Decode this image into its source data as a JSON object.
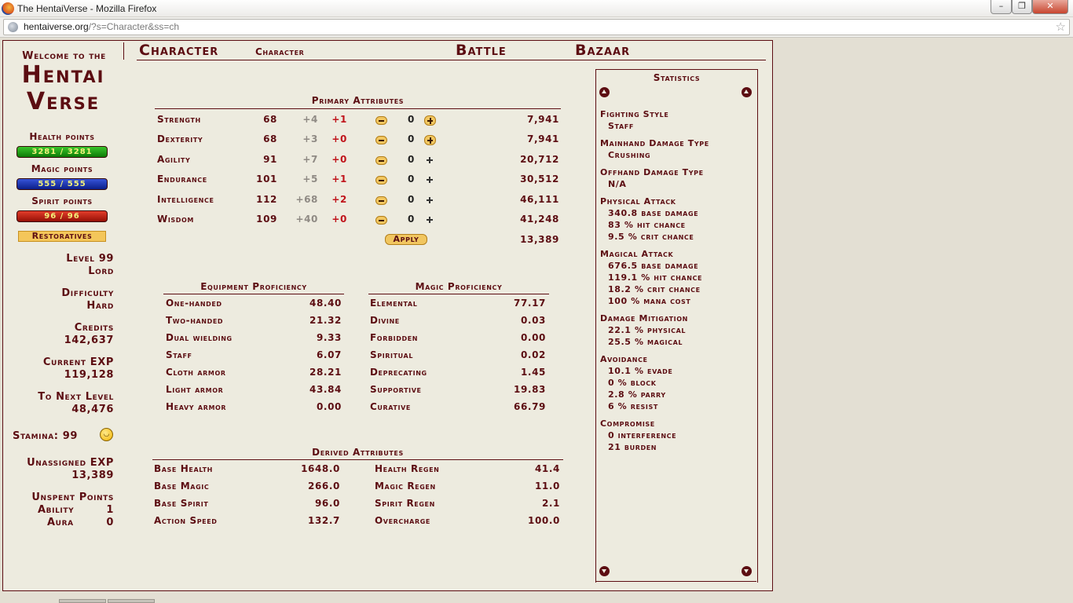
{
  "browser": {
    "window_title": "The HentaiVerse - Mozilla Firefox",
    "url_host": "hentaiverse.org",
    "url_path": "/?s=Character&ss=ch",
    "min_label": "–",
    "max_label": "❐",
    "close_label": "✕"
  },
  "logo": {
    "welcome": "Welcome to the",
    "line1": "Hentai",
    "line2": "Verse"
  },
  "vitals": {
    "health_label": "Health points",
    "health_value": "3281 / 3281",
    "magic_label": "Magic points",
    "magic_value": "555 / 555",
    "spirit_label": "Spirit points",
    "spirit_value": "96 / 96",
    "restoratives": "Restoratives"
  },
  "player": {
    "level": "Level 99",
    "title": "Lord",
    "difficulty_label": "Difficulty",
    "difficulty": "Hard",
    "credits_label": "Credits",
    "credits": "142,637",
    "exp_label": "Current EXP",
    "exp": "119,128",
    "next_label": "To Next Level",
    "next": "48,476",
    "stamina": "Stamina: 99",
    "unassigned_label": "Unassigned EXP",
    "unassigned": "13,389",
    "unspent_label": "Unspent Points",
    "ability_label": "Ability",
    "ability": "1",
    "aura_label": "Aura",
    "aura": "0"
  },
  "menu": {
    "character": "Character",
    "character_sub": "Character",
    "battle": "Battle",
    "bazaar": "Bazaar"
  },
  "primary": {
    "header": "Primary Attributes",
    "rows": [
      {
        "name": "Strength",
        "base": "68",
        "bonus": "+4",
        "mod": "+1",
        "assign": "0",
        "cost": "7,941"
      },
      {
        "name": "Dexterity",
        "base": "68",
        "bonus": "+3",
        "mod": "+0",
        "assign": "0",
        "cost": "7,941"
      },
      {
        "name": "Agility",
        "base": "91",
        "bonus": "+7",
        "mod": "+0",
        "assign": "0",
        "cost": "20,712"
      },
      {
        "name": "Endurance",
        "base": "101",
        "bonus": "+5",
        "mod": "+1",
        "assign": "0",
        "cost": "30,512"
      },
      {
        "name": "Intelligence",
        "base": "112",
        "bonus": "+68",
        "mod": "+2",
        "assign": "0",
        "cost": "46,111"
      },
      {
        "name": "Wisdom",
        "base": "109",
        "bonus": "+40",
        "mod": "+0",
        "assign": "0",
        "cost": "41,248"
      }
    ],
    "apply": "Apply",
    "remaining": "13,389"
  },
  "equipment": {
    "header": "Equipment Proficiency",
    "rows": [
      {
        "name": "One-handed",
        "value": "48.40"
      },
      {
        "name": "Two-handed",
        "value": "21.32"
      },
      {
        "name": "Dual wielding",
        "value": "9.33"
      },
      {
        "name": "Staff",
        "value": "6.07"
      },
      {
        "name": "Cloth armor",
        "value": "28.21"
      },
      {
        "name": "Light armor",
        "value": "43.84"
      },
      {
        "name": "Heavy armor",
        "value": "0.00"
      }
    ]
  },
  "magic": {
    "header": "Magic Proficiency",
    "rows": [
      {
        "name": "Elemental",
        "value": "77.17"
      },
      {
        "name": "Divine",
        "value": "0.03"
      },
      {
        "name": "Forbidden",
        "value": "0.00"
      },
      {
        "name": "Spiritual",
        "value": "0.02"
      },
      {
        "name": "Deprecating",
        "value": "1.45"
      },
      {
        "name": "Supportive",
        "value": "19.83"
      },
      {
        "name": "Curative",
        "value": "66.79"
      }
    ]
  },
  "derived": {
    "header": "Derived Attributes",
    "left": [
      {
        "name": "Base Health",
        "value": "1648.0"
      },
      {
        "name": "Base Magic",
        "value": "266.0"
      },
      {
        "name": "Base Spirit",
        "value": "96.0"
      },
      {
        "name": "Action Speed",
        "value": "132.7"
      }
    ],
    "right": [
      {
        "name": "Health Regen",
        "value": "41.4"
      },
      {
        "name": "Magic Regen",
        "value": "11.0"
      },
      {
        "name": "Spirit Regen",
        "value": "2.1"
      },
      {
        "name": "Overcharge",
        "value": "100.0"
      }
    ]
  },
  "statistics": {
    "header": "Statistics",
    "lines": [
      {
        "text": "Fighting Style",
        "indent": false
      },
      {
        "text": "Staff",
        "indent": true
      },
      {
        "text": "Mainhand Damage Type",
        "indent": false
      },
      {
        "text": "Crushing",
        "indent": true
      },
      {
        "text": "Offhand Damage Type",
        "indent": false
      },
      {
        "text": "N/A",
        "indent": true
      },
      {
        "text": "Physical Attack",
        "indent": false
      },
      {
        "text": "340.8 base damage",
        "indent": true
      },
      {
        "text": "83 % hit chance",
        "indent": true
      },
      {
        "text": "9.5 % crit chance",
        "indent": true
      },
      {
        "text": "Magical Attack",
        "indent": false
      },
      {
        "text": "676.5 base damage",
        "indent": true
      },
      {
        "text": "119.1 % hit chance",
        "indent": true
      },
      {
        "text": "18.2 % crit chance",
        "indent": true
      },
      {
        "text": "100 % mana cost",
        "indent": true
      },
      {
        "text": "Damage Mitigation",
        "indent": false
      },
      {
        "text": "22.1 % physical",
        "indent": true
      },
      {
        "text": "25.5 % magical",
        "indent": true
      },
      {
        "text": "Avoidance",
        "indent": false
      },
      {
        "text": "10.1 % evade",
        "indent": true
      },
      {
        "text": "0 % block",
        "indent": true
      },
      {
        "text": "2.8 % parry",
        "indent": true
      },
      {
        "text": "6 % resist",
        "indent": true
      },
      {
        "text": "Compromise",
        "indent": false
      },
      {
        "text": "0 interference",
        "indent": true
      },
      {
        "text": "21 burden",
        "indent": true
      }
    ]
  }
}
